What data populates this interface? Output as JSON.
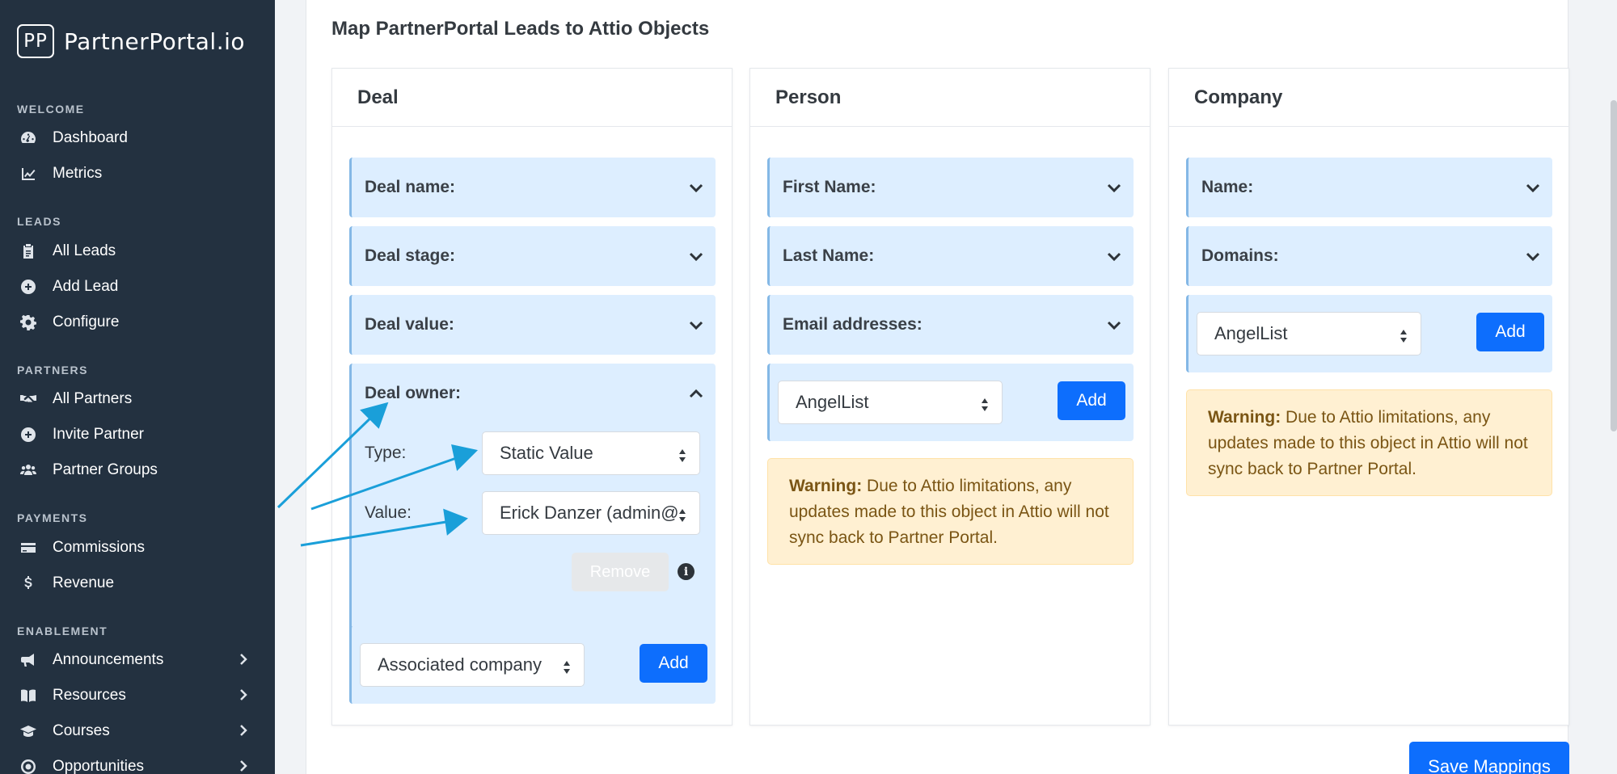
{
  "brand": {
    "logo": "PP",
    "name": "PartnerPortal.io"
  },
  "sidebar": {
    "sections": [
      {
        "title": "WELCOME",
        "items": [
          {
            "label": "Dashboard",
            "icon": "gauge-icon"
          },
          {
            "label": "Metrics",
            "icon": "chart-line-icon"
          }
        ]
      },
      {
        "title": "LEADS",
        "items": [
          {
            "label": "All Leads",
            "icon": "clipboard-icon"
          },
          {
            "label": "Add Lead",
            "icon": "plus-circle-icon"
          },
          {
            "label": "Configure",
            "icon": "gear-icon"
          }
        ]
      },
      {
        "title": "PARTNERS",
        "items": [
          {
            "label": "All Partners",
            "icon": "handshake-icon"
          },
          {
            "label": "Invite Partner",
            "icon": "plus-circle-icon"
          },
          {
            "label": "Partner Groups",
            "icon": "users-icon"
          }
        ]
      },
      {
        "title": "PAYMENTS",
        "items": [
          {
            "label": "Commissions",
            "icon": "credit-card-icon"
          },
          {
            "label": "Revenue",
            "icon": "dollar-icon"
          }
        ]
      },
      {
        "title": "ENABLEMENT",
        "items": [
          {
            "label": "Announcements",
            "icon": "megaphone-icon"
          },
          {
            "label": "Resources",
            "icon": "book-icon"
          },
          {
            "label": "Courses",
            "icon": "graduation-cap-icon"
          },
          {
            "label": "Opportunities",
            "icon": "target-icon"
          }
        ]
      }
    ]
  },
  "page": {
    "title": "Map PartnerPortal Leads to Attio Objects"
  },
  "columns": {
    "deal": {
      "title": "Deal",
      "fields": [
        "Deal name:",
        "Deal stage:",
        "Deal value:",
        "Deal owner:"
      ],
      "owner": {
        "type_label": "Type:",
        "type_value": "Static Value",
        "value_label": "Value:",
        "value_value": "Erick Danzer (admin@",
        "remove_label": "Remove",
        "info": "i"
      },
      "add_select": "Associated company",
      "add_label": "Add"
    },
    "person": {
      "title": "Person",
      "fields": [
        "First Name:",
        "Last Name:",
        "Email addresses:"
      ],
      "add_select": "AngelList",
      "add_label": "Add",
      "warning_bold": "Warning:",
      "warning_text": " Due to Attio limitations, any updates made to this object in Attio will not sync back to Partner Portal."
    },
    "company": {
      "title": "Company",
      "fields": [
        "Name:",
        "Domains:"
      ],
      "add_select": "AngelList",
      "add_label": "Add",
      "warning_bold": "Warning:",
      "warning_text": " Due to Attio limitations, any updates made to this object in Attio will not sync back to Partner Portal."
    }
  },
  "save_label": "Save Mappings",
  "colors": {
    "sidebar": "#233140",
    "accent": "#0d6efd",
    "field_bg": "#ddeeff",
    "warning_bg": "#fff0d2",
    "annotation_arrow": "#1a9fd9"
  }
}
